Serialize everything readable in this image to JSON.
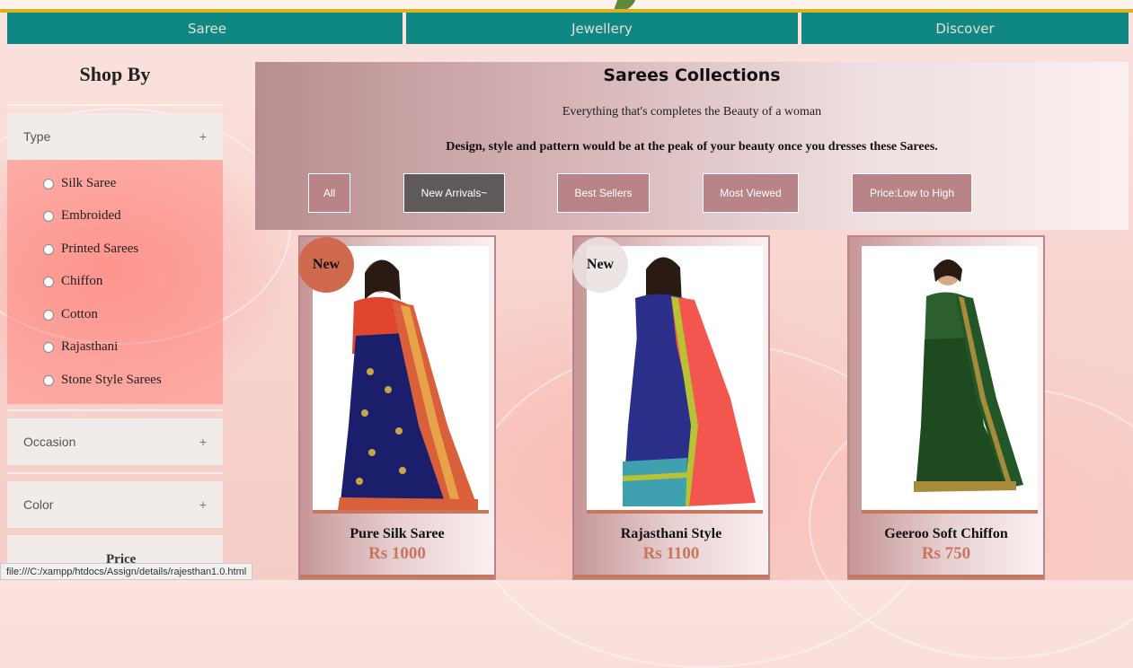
{
  "nav": {
    "items": [
      {
        "label": "Saree"
      },
      {
        "label": "Jewellery"
      },
      {
        "label": "Discover"
      }
    ]
  },
  "sidebar": {
    "title": "Shop By",
    "type_header": "Type",
    "options": [
      "Silk Saree",
      "Embroided",
      "Printed Sarees",
      "Chiffon",
      "Cotton",
      "Rajasthani",
      "Stone Style Sarees"
    ],
    "occasion_header": "Occasion",
    "color_header": "Color",
    "price_header": "Price",
    "expand_symbol": "+"
  },
  "banner": {
    "title": "Sarees Collections",
    "subtitle": "Everything that's completes the Beauty of a woman",
    "description": "Design, style and pattern would be at the peak of your beauty once you dresses these Sarees.",
    "filters": [
      "All",
      "New Arrivals~",
      "Best Sellers",
      "Most Viewed",
      "Price:Low to High"
    ],
    "active_filter": "New Arrivals~"
  },
  "products": [
    {
      "name": "Pure Silk Saree",
      "price": "Rs 1000",
      "badge": "New",
      "colors": {
        "saree": "#1b1f6b",
        "border": "#d9603a",
        "blouse": "#e0452e"
      }
    },
    {
      "name": "Rajasthani Style",
      "price": "Rs 1100",
      "badge": "New",
      "colors": {
        "saree": "#f2564f",
        "border": "#b7c234",
        "blouse": "#2a2f8a"
      }
    },
    {
      "name": "Geeroo Soft Chiffon",
      "price": "Rs 750",
      "badge": "",
      "colors": {
        "saree": "#1d4a1f",
        "border": "#a58b3a",
        "blouse": "#2c5e2e"
      }
    }
  ],
  "status_bar": "file:///C:/xampp/htdocs/Assign/details/rajesthan1.0.html",
  "theme": {
    "nav_bg": "#0f8783",
    "accent": "#c9765f",
    "gold": "#d9b21d"
  }
}
